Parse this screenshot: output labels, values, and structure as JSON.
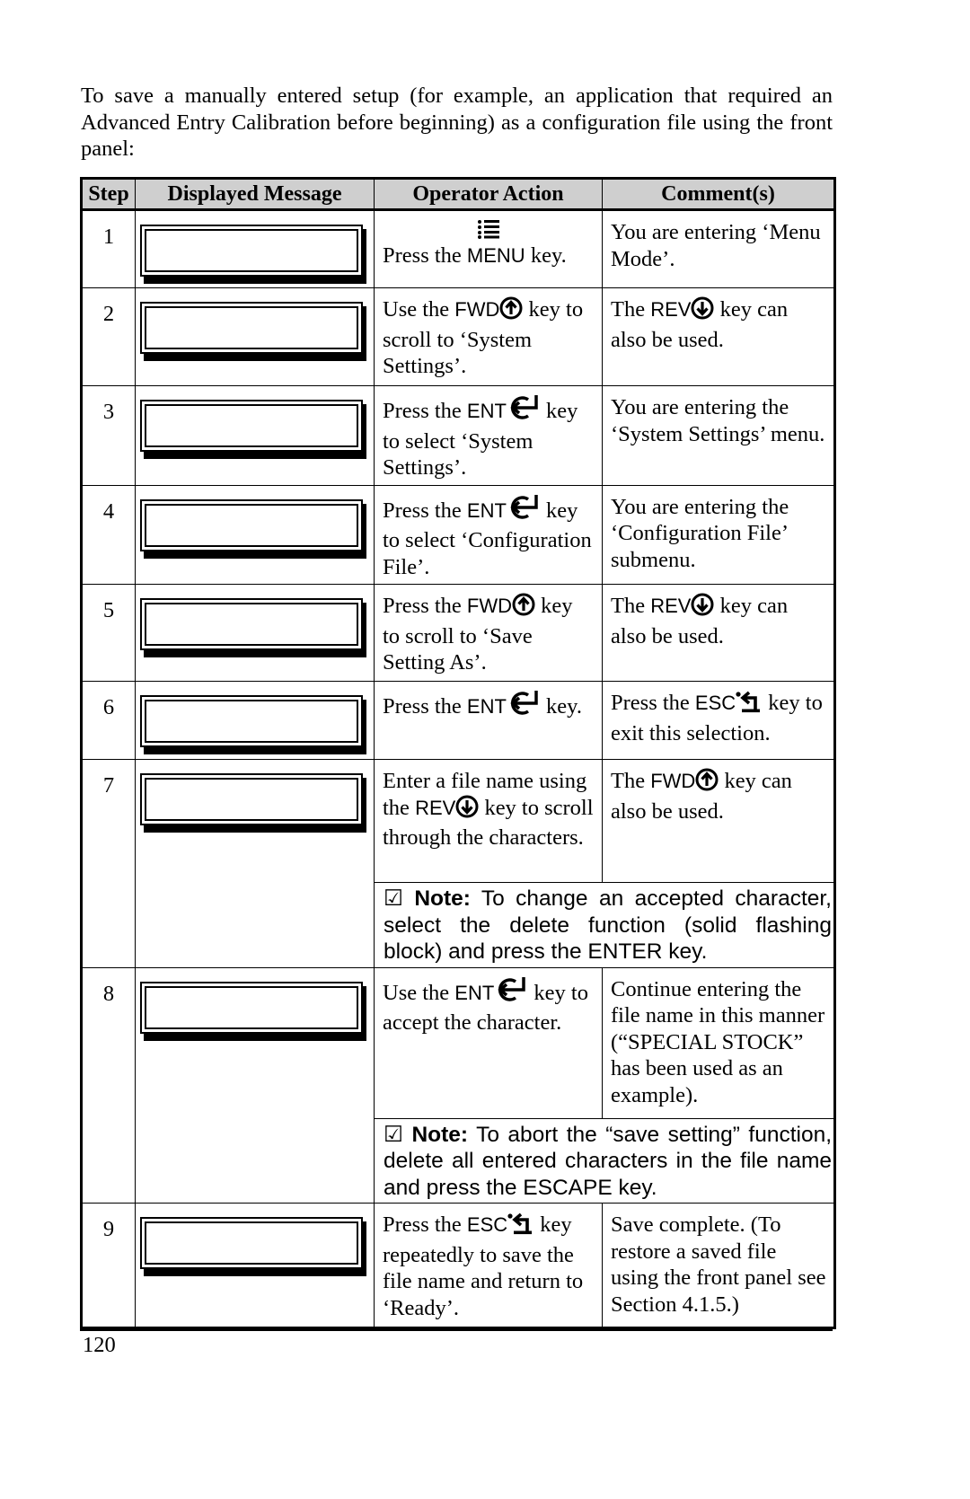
{
  "intro": "To save a manually entered setup (for example, an application that required an Advanced Entry Calibration before beginning) as a configuration file using the front panel:",
  "table": {
    "headers": [
      "Step",
      "Displayed Message",
      "Operator Action",
      "Comment(s)"
    ],
    "keys": {
      "menu": "MENU",
      "fwd": "FWD",
      "rev": "REV",
      "ent": "ENT",
      "esc": "ESC"
    },
    "rows": [
      {
        "step": "1",
        "display": "",
        "action": {
          "pre": "Press the ",
          "key": "MENU",
          "post": " key."
        },
        "comment": "You are entering ‘Menu Mode’."
      },
      {
        "step": "2",
        "display": "",
        "action": {
          "pre": "Use the ",
          "key": "FWD",
          "post": " key to scroll to ‘System Settings’."
        },
        "comment": {
          "pre": "The ",
          "key": "REV",
          "post": " key can also be used."
        }
      },
      {
        "step": "3",
        "display": "",
        "action": {
          "pre": "Press the ",
          "key": "ENT",
          "post": " key to select ‘System Settings’."
        },
        "comment": "You are entering the ‘System Settings’ menu."
      },
      {
        "step": "4",
        "display": "",
        "action": {
          "pre": "Press the ",
          "key": "ENT",
          "post": " key to select ‘Configuration File’."
        },
        "comment": "You are entering the ‘Configuration File’ submenu."
      },
      {
        "step": "5",
        "display": "",
        "action": {
          "pre": "Press the ",
          "key": "FWD",
          "post": " key to scroll to  ‘Save Setting As’."
        },
        "comment": {
          "pre": "The ",
          "key": "REV",
          "post": " key can also be used."
        }
      },
      {
        "step": "6",
        "display": "",
        "action": {
          "pre": "Press the ",
          "key": "ENT",
          "post": " key."
        },
        "comment": {
          "pre": "Press the ",
          "key": "ESC",
          "post": " key to exit this selection."
        }
      },
      {
        "step": "7",
        "display": "",
        "action": {
          "pre": "Enter a file name using the ",
          "key": "REV",
          "post": " key to scroll through the characters."
        },
        "comment": {
          "pre": "The ",
          "key": "FWD",
          "post": " key can also be used."
        },
        "note": {
          "label": "Note:",
          "text": " To change an accepted character, select the delete function (solid flashing block) and press the ENTER key."
        }
      },
      {
        "step": "8",
        "display": "",
        "action": {
          "pre": "Use the ",
          "key": "ENT",
          "post": " key to accept the character."
        },
        "comment": "Continue entering the file name in this manner (“SPECIAL STOCK” has been used as an example).",
        "note": {
          "label": "Note:",
          "text": " To abort the “save setting” function, delete all entered characters in the file name and press the ESCAPE key."
        }
      },
      {
        "step": "9",
        "display": "",
        "action": {
          "pre": "Press the ",
          "key": "ESC",
          "post": " key repeatedly to save the file name and return to ‘Ready’."
        },
        "comment": "Save complete.  (To restore a saved file using the front panel see Section 4.1.5.)"
      }
    ]
  },
  "footer": {
    "page_number": "120"
  }
}
